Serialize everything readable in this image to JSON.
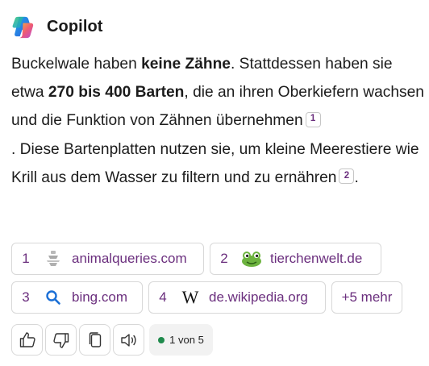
{
  "header": {
    "title": "Copilot"
  },
  "answer": {
    "p1": "Buckelwale haben ",
    "bold1": "keine Zähne",
    "p2": ". Stattdessen haben sie etwa ",
    "bold2": "270 bis 400 Barten",
    "p3": ", die an ihren Oberkiefern wachsen und die Funktion von Zähnen übernehmen",
    "cite1": "1",
    "p4": ". Diese Bartenplatten nutzen sie, um kleine Meerestiere wie Krill aus dem Wasser zu filtern und zu ernähren",
    "cite2": "2",
    "p5": "."
  },
  "sources": [
    {
      "num": "1",
      "label": "animalqueries.com",
      "icon": "animalqueries-logo-icon"
    },
    {
      "num": "2",
      "label": "tierchenwelt.de",
      "icon": "frog-logo-icon"
    },
    {
      "num": "3",
      "label": "bing.com",
      "icon": "search-icon"
    },
    {
      "num": "4",
      "label": "de.wikipedia.org",
      "icon": "wikipedia-icon",
      "icon_glyph": "W"
    }
  ],
  "more_sources": "+5 mehr",
  "actions": {
    "buttons": [
      "thumbs-up-icon",
      "thumbs-down-icon",
      "copy-icon",
      "speaker-icon"
    ],
    "counter": "1 von 5"
  },
  "colors": {
    "accent": "#6b2f7e",
    "status_dot": "#1f8a4c",
    "chip_border": "#d8d8d8"
  }
}
